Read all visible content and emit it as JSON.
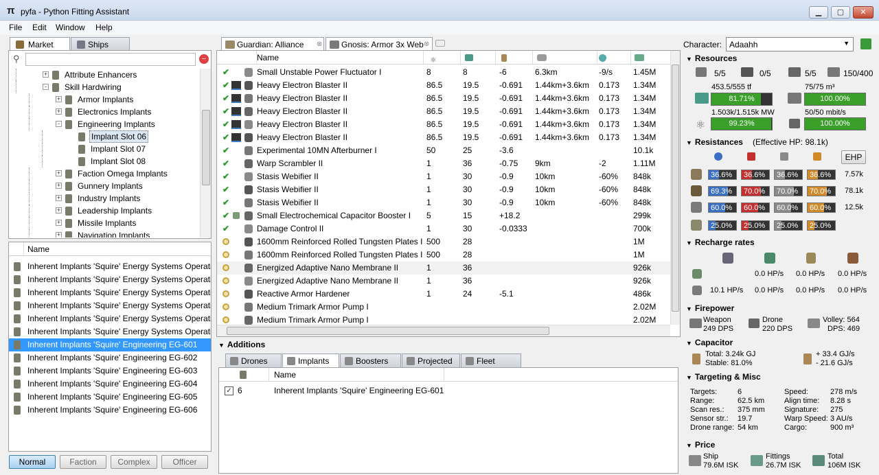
{
  "window": {
    "title": "pyfa - Python Fitting Assistant"
  },
  "menu": [
    "File",
    "Edit",
    "Window",
    "Help"
  ],
  "left": {
    "tabs": [
      "Market",
      "Ships"
    ],
    "tree": [
      {
        "label": "Attribute Enhancers",
        "indent": 0,
        "exp": "+"
      },
      {
        "label": "Skill Hardwiring",
        "indent": 0,
        "exp": "-"
      },
      {
        "label": "Armor Implants",
        "indent": 1,
        "exp": "+"
      },
      {
        "label": "Electronics Implants",
        "indent": 1,
        "exp": "+"
      },
      {
        "label": "Engineering Implants",
        "indent": 1,
        "exp": "-"
      },
      {
        "label": "Implant Slot 06",
        "indent": 2,
        "exp": "",
        "sel": true
      },
      {
        "label": "Implant Slot 07",
        "indent": 2,
        "exp": ""
      },
      {
        "label": "Implant Slot 08",
        "indent": 2,
        "exp": ""
      },
      {
        "label": "Faction Omega Implants",
        "indent": 1,
        "exp": "+"
      },
      {
        "label": "Gunnery Implants",
        "indent": 1,
        "exp": "+"
      },
      {
        "label": "Industry Implants",
        "indent": 1,
        "exp": "+"
      },
      {
        "label": "Leadership Implants",
        "indent": 1,
        "exp": "+"
      },
      {
        "label": "Missile Implants",
        "indent": 1,
        "exp": "+"
      },
      {
        "label": "Navigation Implants",
        "indent": 1,
        "exp": "+"
      }
    ],
    "list_header": "Name",
    "items": [
      "Inherent Implants 'Squire' Energy Systems Operation",
      "Inherent Implants 'Squire' Energy Systems Operation",
      "Inherent Implants 'Squire' Energy Systems Operation",
      "Inherent Implants 'Squire' Energy Systems Operation",
      "Inherent Implants 'Squire' Energy Systems Operation",
      "Inherent Implants 'Squire' Energy Systems Operation",
      "Inherent Implants 'Squire' Engineering EG-601",
      "Inherent Implants 'Squire' Engineering EG-602",
      "Inherent Implants 'Squire' Engineering EG-603",
      "Inherent Implants 'Squire' Engineering EG-604",
      "Inherent Implants 'Squire' Engineering EG-605",
      "Inherent Implants 'Squire' Engineering EG-606"
    ],
    "selected_index": 6,
    "meta_buttons": [
      "Normal",
      "Faction",
      "Complex",
      "Officer"
    ]
  },
  "fits": {
    "tabs": [
      "Guardian: Alliance",
      "Gnosis: Armor 3x Web"
    ],
    "name_header": "Name",
    "modules": [
      {
        "state": "check",
        "name": "Small Unstable Power Fluctuator I",
        "c1": "8",
        "c2": "8",
        "c3": "-6",
        "c4": "6.3km",
        "c5": "-9/s",
        "c6": "1.45M"
      },
      {
        "state": "check",
        "name": "Heavy Electron Blaster II",
        "c1": "86.5",
        "c2": "19.5",
        "c3": "-0.691",
        "c4": "1.44km+3.6km",
        "c5": "0.173",
        "c6": "1.34M"
      },
      {
        "state": "check",
        "name": "Heavy Electron Blaster II",
        "c1": "86.5",
        "c2": "19.5",
        "c3": "-0.691",
        "c4": "1.44km+3.6km",
        "c5": "0.173",
        "c6": "1.34M"
      },
      {
        "state": "check",
        "name": "Heavy Electron Blaster II",
        "c1": "86.5",
        "c2": "19.5",
        "c3": "-0.691",
        "c4": "1.44km+3.6km",
        "c5": "0.173",
        "c6": "1.34M"
      },
      {
        "state": "check",
        "name": "Heavy Electron Blaster II",
        "c1": "86.5",
        "c2": "19.5",
        "c3": "-0.691",
        "c4": "1.44km+3.6km",
        "c5": "0.173",
        "c6": "1.34M"
      },
      {
        "state": "check",
        "name": "Heavy Electron Blaster II",
        "c1": "86.5",
        "c2": "19.5",
        "c3": "-0.691",
        "c4": "1.44km+3.6km",
        "c5": "0.173",
        "c6": "1.34M"
      },
      {
        "state": "check",
        "name": "Experimental 10MN Afterburner I",
        "c1": "50",
        "c2": "25",
        "c3": "-3.6",
        "c4": "",
        "c5": "",
        "c6": "10.1k"
      },
      {
        "state": "check",
        "name": "Warp Scrambler II",
        "c1": "1",
        "c2": "36",
        "c3": "-0.75",
        "c4": "9km",
        "c5": "-2",
        "c6": "1.11M"
      },
      {
        "state": "check",
        "name": "Stasis Webifier II",
        "c1": "1",
        "c2": "30",
        "c3": "-0.9",
        "c4": "10km",
        "c5": "-60%",
        "c6": "848k"
      },
      {
        "state": "check",
        "name": "Stasis Webifier II",
        "c1": "1",
        "c2": "30",
        "c3": "-0.9",
        "c4": "10km",
        "c5": "-60%",
        "c6": "848k"
      },
      {
        "state": "check",
        "name": "Stasis Webifier II",
        "c1": "1",
        "c2": "30",
        "c3": "-0.9",
        "c4": "10km",
        "c5": "-60%",
        "c6": "848k"
      },
      {
        "state": "check",
        "name": "Small Electrochemical Capacitor Booster I",
        "c1": "5",
        "c2": "15",
        "c3": "+18.2",
        "c4": "",
        "c5": "",
        "c6": "299k"
      },
      {
        "state": "check",
        "name": "Damage Control II",
        "c1": "1",
        "c2": "30",
        "c3": "-0.0333",
        "c4": "",
        "c5": "",
        "c6": "700k"
      },
      {
        "state": "online",
        "name": "1600mm Reinforced Rolled Tungsten Plates I",
        "c1": "500",
        "c2": "28",
        "c3": "",
        "c4": "",
        "c5": "",
        "c6": "1M"
      },
      {
        "state": "online",
        "name": "1600mm Reinforced Rolled Tungsten Plates I",
        "c1": "500",
        "c2": "28",
        "c3": "",
        "c4": "",
        "c5": "",
        "c6": "1M"
      },
      {
        "state": "online",
        "name": "Energized Adaptive Nano Membrane II",
        "c1": "1",
        "c2": "36",
        "c3": "",
        "c4": "",
        "c5": "",
        "c6": "926k"
      },
      {
        "state": "online",
        "name": "Energized Adaptive Nano Membrane II",
        "c1": "1",
        "c2": "36",
        "c3": "",
        "c4": "",
        "c5": "",
        "c6": "926k"
      },
      {
        "state": "online",
        "name": "Reactive Armor Hardener",
        "c1": "1",
        "c2": "24",
        "c3": "-5.1",
        "c4": "",
        "c5": "",
        "c6": "486k"
      },
      {
        "state": "online",
        "name": "Medium Trimark Armor Pump I",
        "c1": "",
        "c2": "",
        "c3": "",
        "c4": "",
        "c5": "",
        "c6": "2.02M"
      },
      {
        "state": "online",
        "name": "Medium Trimark Armor Pump I",
        "c1": "",
        "c2": "",
        "c3": "",
        "c4": "",
        "c5": "",
        "c6": "2.02M"
      }
    ]
  },
  "additions": {
    "title": "Additions",
    "tabs": [
      "Drones",
      "Implants",
      "Boosters",
      "Projected",
      "Fleet"
    ],
    "header": "Name",
    "rows": [
      {
        "slot": "6",
        "name": "Inherent Implants 'Squire' Engineering EG-601"
      }
    ]
  },
  "stats": {
    "character_label": "Character:",
    "character": "Adaahh",
    "resources": {
      "title": "Resources",
      "hardpoints": [
        "5/5",
        "0/5",
        "5/5",
        "150/400"
      ],
      "cpu": "453.5/555 tf",
      "cpu_pct": "81.71%",
      "cpu_frac": 0.8171,
      "drone_bay": "75/75 m³",
      "drone_bay_pct": "100.00%",
      "drone_bay_frac": 1.0,
      "power": "1.503k/1.515k MW",
      "power_pct": "99.23%",
      "power_frac": 0.9923,
      "bandwidth": "50/50 mbit/s",
      "bandwidth_pct": "100.00%",
      "bandwidth_frac": 1.0
    },
    "resistances": {
      "title": "Resistances",
      "ehp_text": "(Effective HP: 98.1k)",
      "ehp_button": "EHP",
      "rows": [
        {
          "vals": [
            "36.6%",
            "36.6%",
            "36.6%",
            "36.6%"
          ],
          "hp": "7.57k"
        },
        {
          "vals": [
            "69.3%",
            "70.0%",
            "70.0%",
            "70.0%"
          ],
          "hp": "78.1k"
        },
        {
          "vals": [
            "60.0%",
            "60.0%",
            "60.0%",
            "60.0%"
          ],
          "hp": "12.5k"
        },
        {
          "vals": [
            "25.0%",
            "25.0%",
            "25.0%",
            "25.0%"
          ],
          "hp": ""
        }
      ]
    },
    "recharge": {
      "title": "Recharge rates",
      "row1": [
        "",
        "0.0 HP/s",
        "0.0 HP/s",
        "0.0 HP/s"
      ],
      "row2": [
        "10.1 HP/s",
        "0.0 HP/s",
        "0.0 HP/s",
        "0.0 HP/s"
      ]
    },
    "firepower": {
      "title": "Firepower",
      "weapon_label": "Weapon",
      "weapon": "249 DPS",
      "drone_label": "Drone",
      "drone": "220 DPS",
      "volley_label": "Volley: 564",
      "dps_label": "DPS: 469"
    },
    "capacitor": {
      "title": "Capacitor",
      "total": "Total: 3.24k GJ",
      "stable": "Stable: 81.0%",
      "plus": "+ 33.4 GJ/s",
      "minus": "- 21.6 GJ/s"
    },
    "targeting": {
      "title": "Targeting & Misc",
      "left": [
        [
          "Targets:",
          "6"
        ],
        [
          "Range:",
          "62.5 km"
        ],
        [
          "Scan res.:",
          "375 mm"
        ],
        [
          "Sensor str.:",
          "19.7"
        ],
        [
          "Drone range:",
          "54 km"
        ]
      ],
      "right": [
        [
          "Speed:",
          "278 m/s"
        ],
        [
          "Align time:",
          "8.28 s"
        ],
        [
          "Signature:",
          "275"
        ],
        [
          "Warp Speed:",
          "3 AU/s"
        ],
        [
          "Cargo:",
          "900 m³"
        ]
      ]
    },
    "price": {
      "title": "Price",
      "ship_label": "Ship",
      "ship": "79.6M ISK",
      "fittings_label": "Fittings",
      "fittings": "26.7M ISK",
      "total_label": "Total",
      "total": "106M ISK"
    }
  },
  "colors": {
    "em": "#3a6fc4",
    "thermal": "#c43030",
    "kinetic": "#8a8a8a",
    "explosive": "#d08a2a",
    "green": "#3aa02a",
    "select": "#3399ff"
  }
}
